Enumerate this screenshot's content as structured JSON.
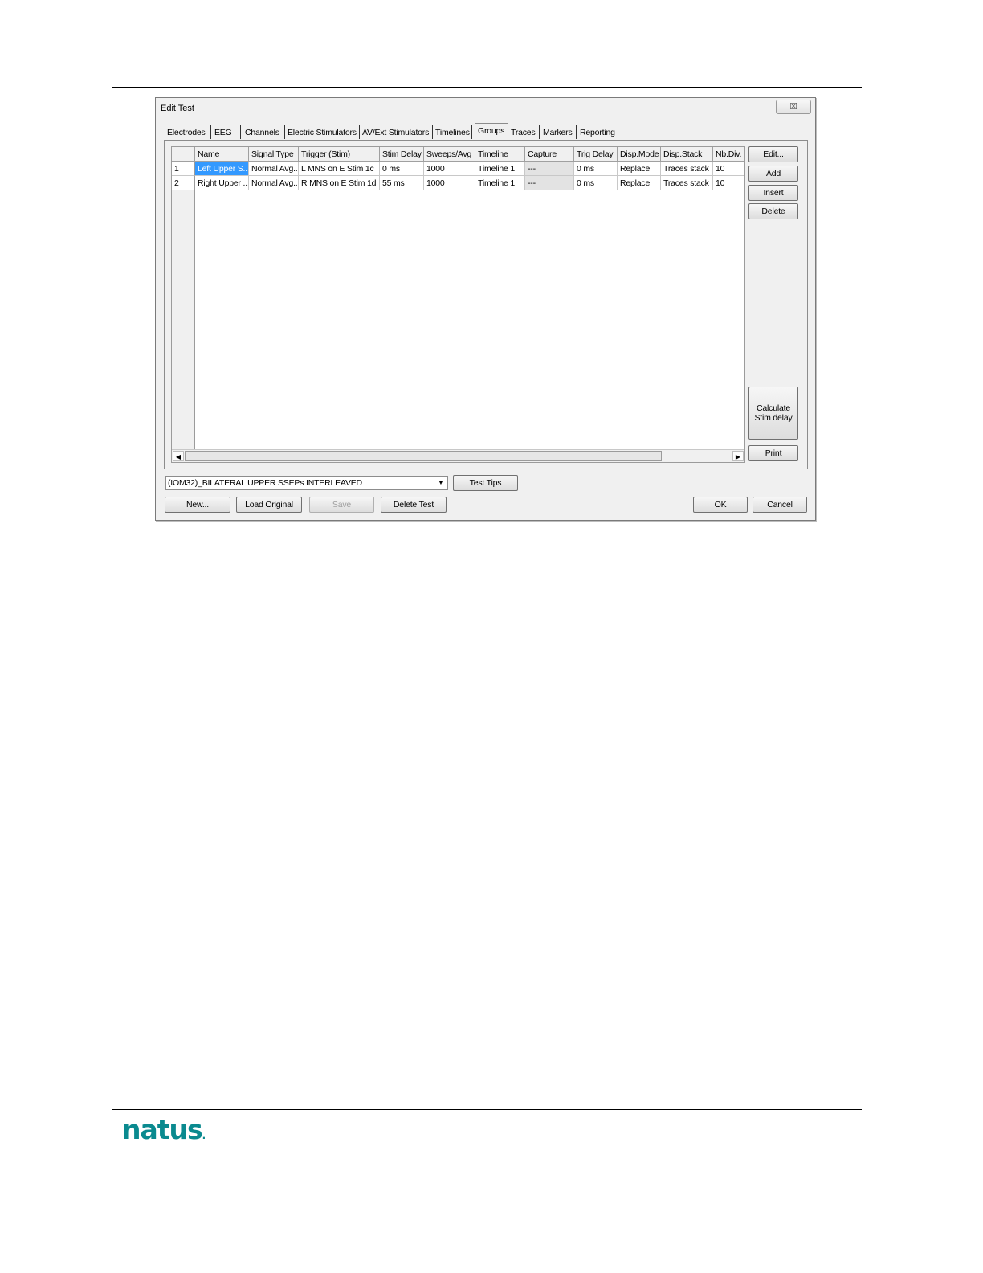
{
  "dialog": {
    "title": "Edit Test",
    "close_glyph": "☒",
    "tabs": [
      {
        "label": "Electrodes",
        "active": false
      },
      {
        "label": "EEG",
        "active": false
      },
      {
        "label": "Channels",
        "active": false
      },
      {
        "label": "Electric Stimulators",
        "active": false
      },
      {
        "label": "AV/Ext Stimulators",
        "active": false
      },
      {
        "label": "Timelines",
        "active": false
      },
      {
        "label": "Groups",
        "active": true
      },
      {
        "label": "Traces",
        "active": false
      },
      {
        "label": "Markers",
        "active": false
      },
      {
        "label": "Reporting",
        "active": false
      }
    ],
    "grid": {
      "columns": [
        "Name",
        "Signal Type",
        "Trigger (Stim)",
        "Stim Delay",
        "Sweeps/Avg",
        "Timeline",
        "Capture",
        "Trig Delay",
        "Disp.Mode",
        "Disp.Stack",
        "Nb.Div."
      ],
      "rows": [
        {
          "index": "1",
          "cells": [
            "Left Upper S...",
            "Normal Avg...",
            "L MNS on E Stim 1c",
            "0 ms",
            "1000",
            "Timeline 1",
            "---",
            "0 ms",
            "Replace",
            "Traces stack",
            "10"
          ]
        },
        {
          "index": "2",
          "cells": [
            "Right Upper ...",
            "Normal Avg...",
            "R MNS on E Stim 1d",
            "55 ms",
            "1000",
            "Timeline 1",
            "---",
            "0 ms",
            "Replace",
            "Traces stack",
            "10"
          ]
        }
      ]
    },
    "side_buttons": {
      "edit": "Edit...",
      "add": "Add",
      "insert": "Insert",
      "delete": "Delete",
      "calculate": "Calculate\nStim delay",
      "print": "Print"
    },
    "test_select": {
      "value": "(IOM32)_BILATERAL UPPER SSEPs INTERLEAVED"
    },
    "bottom_buttons": {
      "test_tips": "Test Tips",
      "new": "New...",
      "load_original": "Load Original",
      "save": "Save",
      "delete_test": "Delete Test",
      "ok": "OK",
      "cancel": "Cancel"
    }
  },
  "footer": {
    "logo_text": "natus",
    "logo_mark": "."
  }
}
